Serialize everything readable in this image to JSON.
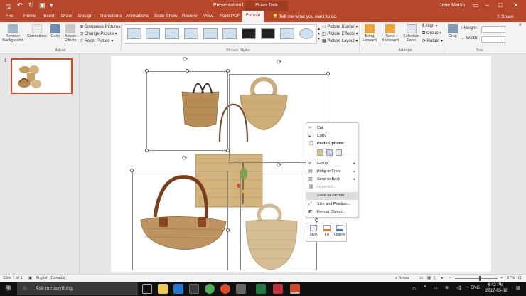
{
  "window": {
    "title": "Presentation1 - PowerPoint",
    "context_label": "Picture Tools",
    "user": "Jane Martin",
    "share": "Share",
    "tell_me": "Tell me what you want to do"
  },
  "tabs": [
    "File",
    "Home",
    "Insert",
    "Draw",
    "Design",
    "Transitions",
    "Animations",
    "Slide Show",
    "Review",
    "View",
    "Foxit PDF",
    "Format"
  ],
  "ribbon": {
    "remove_background": "Remove Background",
    "corrections": "Corrections",
    "color": "Color",
    "artistic_effects": "Artistic Effects",
    "compress_pictures": "Compress Pictures",
    "change_picture": "Change Picture",
    "reset_picture": "Reset Picture",
    "group_adjust": "Adjust",
    "group_picture_styles": "Picture Styles",
    "picture_border": "Picture Border",
    "picture_effects": "Picture Effects",
    "picture_layout": "Picture Layout",
    "bring_forward": "Bring Forward",
    "send_backward": "Send Backward",
    "selection_pane": "Selection Pane",
    "align": "Align",
    "group": "Group",
    "rotate": "Rotate",
    "group_arrange": "Arrange",
    "crop": "Crop",
    "height_label": "Height:",
    "width_label": "Width:",
    "group_size": "Size"
  },
  "thumbnail": {
    "number": "1"
  },
  "context_menu": {
    "items": [
      {
        "label": "Cut",
        "icon": "scissors-icon",
        "state": "normal"
      },
      {
        "label": "Copy",
        "icon": "copy-icon",
        "state": "normal"
      },
      {
        "label": "Paste Options:",
        "icon": "paste-icon",
        "state": "header"
      },
      {
        "label": "Group",
        "icon": "group-icon",
        "state": "submenu"
      },
      {
        "label": "Bring to Front",
        "icon": "bring-front-icon",
        "state": "submenu"
      },
      {
        "label": "Send to Back",
        "icon": "send-back-icon",
        "state": "submenu"
      },
      {
        "label": "Hyperlink...",
        "icon": "link-icon",
        "state": "disabled"
      },
      {
        "label": "Save as Picture...",
        "icon": "",
        "state": "highlighted"
      },
      {
        "label": "Size and Position...",
        "icon": "size-icon",
        "state": "normal"
      },
      {
        "label": "Format Object...",
        "icon": "format-icon",
        "state": "normal"
      }
    ]
  },
  "mini_toolbar": {
    "style": "Style",
    "fill": "Fill",
    "outline": "Outline"
  },
  "status": {
    "slide": "Slide 1 of 1",
    "language": "English (Canada)",
    "notes": "Notes",
    "zoom": "87%"
  },
  "taskbar": {
    "search": "Ask me anything",
    "lang": "ENG",
    "time": "6:42 PM",
    "date": "2017-05-02"
  },
  "colors": {
    "accent": "#b7472a",
    "accent_dark": "#a13c23"
  }
}
